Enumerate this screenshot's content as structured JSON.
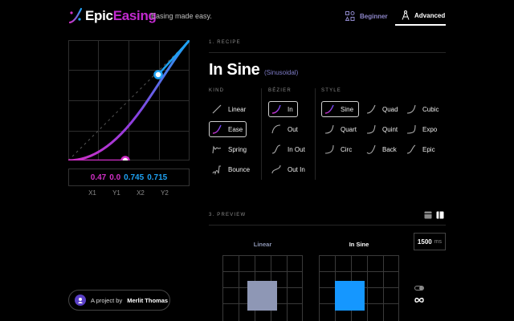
{
  "header": {
    "brand_part1": "Epic",
    "brand_part2": "Easing",
    "tagline": "Easing made easy.",
    "modes": [
      {
        "label": "Beginner",
        "icon": "shapes-icon",
        "active": false
      },
      {
        "label": "Advanced",
        "icon": "compass-icon",
        "active": true
      }
    ]
  },
  "editor": {
    "values": {
      "x1": "0.47",
      "y1": "0.0",
      "x2": "0.745",
      "y2": "0.715"
    },
    "axis_labels": [
      "X1",
      "Y1",
      "X2",
      "Y2"
    ]
  },
  "recipe": {
    "section_title": "1. RECIPE",
    "name": "In Sine",
    "subtitle": "(Sinusoidal)",
    "kind": {
      "heading": "KIND",
      "options": [
        "Linear",
        "Ease",
        "Spring",
        "Bounce"
      ],
      "selected": "Ease"
    },
    "bezier": {
      "heading": "BÉZIER",
      "options": [
        "In",
        "Out",
        "In Out",
        "Out In"
      ],
      "selected": "In"
    },
    "style": {
      "heading": "STYLE",
      "options": [
        "Sine",
        "Quad",
        "Cubic",
        "Quart",
        "Quint",
        "Expo",
        "Circ",
        "Back",
        "Epic"
      ],
      "selected": "Sine"
    }
  },
  "preview": {
    "section_title": "3. PREVIEW",
    "duration_value": "1500",
    "duration_unit": "ms",
    "panels": [
      {
        "label": "Linear",
        "color": "#8e97b5"
      },
      {
        "label": "In Sine",
        "color": "#1597ff"
      }
    ]
  },
  "credit": {
    "prefix": "A project by",
    "author": "Merlit Thomas"
  },
  "colors": {
    "accent_pink": "#d02fc6",
    "accent_blue": "#1ea1f2",
    "brand_purple": "#c22ad0"
  }
}
